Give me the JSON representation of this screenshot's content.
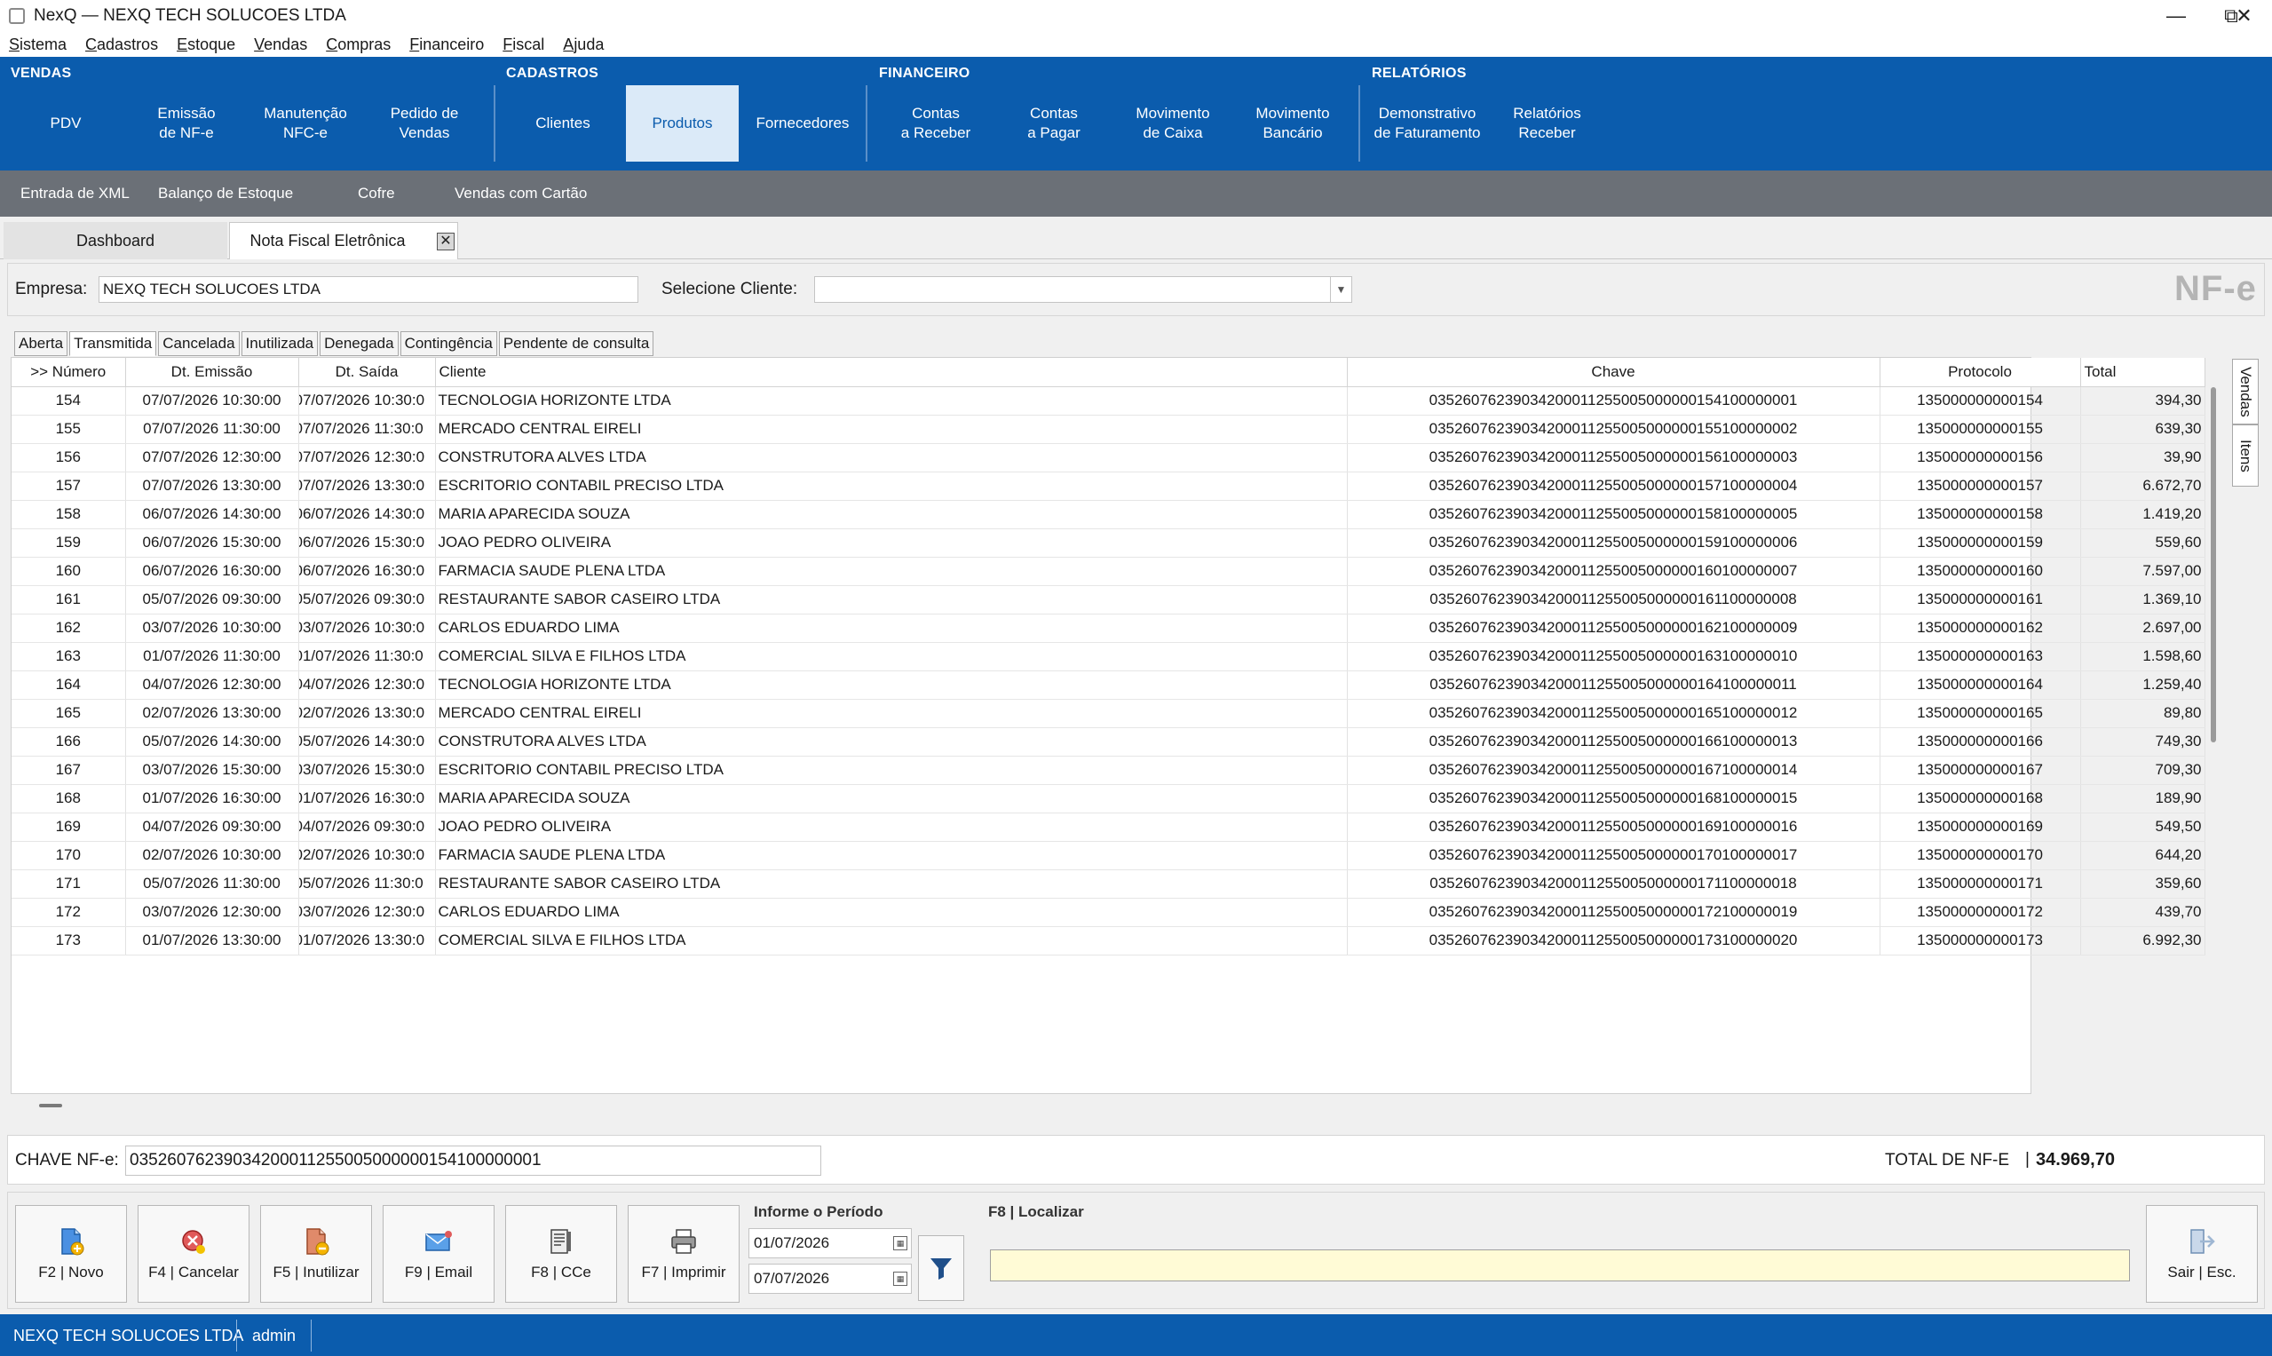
{
  "window": {
    "title": "NexQ — NEXQ TECH SOLUCOES LTDA"
  },
  "menu": [
    "Sistema",
    "Cadastros",
    "Estoque",
    "Vendas",
    "Compras",
    "Financeiro",
    "Fiscal",
    "Ajuda"
  ],
  "ribbon": {
    "groups": [
      "VENDAS",
      "CADASTROS",
      "FINANCEIRO",
      "RELATÓRIOS"
    ],
    "buttons": [
      "PDV",
      "Emissão\nde NF-e",
      "Manutenção\nNFC-e",
      "Pedido de\nVendas",
      "Clientes",
      "Produtos",
      "Fornecedores",
      "Contas\na Receber",
      "Contas\na Pagar",
      "Movimento\nde Caixa",
      "Movimento\nBancário",
      "Demonstrativo\nde Faturamento",
      "Relatórios\nReceber"
    ],
    "active": "Produtos"
  },
  "subbar": [
    "Entrada de XML",
    "Balanço de Estoque",
    "Cofre",
    "Vendas com Cartão"
  ],
  "doc_tabs": [
    "Dashboard",
    "Nota Fiscal Eletrônica"
  ],
  "filter": {
    "empresa_label": "Empresa:",
    "empresa_value": "NEXQ TECH SOLUCOES LTDA",
    "cliente_label": "Selecione Cliente:",
    "cliente_value": "",
    "logo": "NF-e"
  },
  "status_tabs": [
    "Aberta",
    "Transmitida",
    "Cancelada",
    "Inutilizada",
    "Denegada",
    "Contingência",
    "Pendente de consulta"
  ],
  "active_status_tab": "Transmitida",
  "grid": {
    "columns": [
      ">> Número",
      "Dt. Emissão",
      "Dt. Saída",
      "Cliente",
      "Chave",
      "Protocolo",
      "Total"
    ],
    "rows": [
      [
        "154",
        "07/07/2026 10:30:00",
        "07/07/2026 10:30:0",
        "TECNOLOGIA HORIZONTE LTDA",
        "03526076239034200011255005000000154100000001",
        "135000000000154",
        "394,30"
      ],
      [
        "155",
        "07/07/2026 11:30:00",
        "07/07/2026 11:30:0",
        "MERCADO CENTRAL EIRELI",
        "03526076239034200011255005000000155100000002",
        "135000000000155",
        "639,30"
      ],
      [
        "156",
        "07/07/2026 12:30:00",
        "07/07/2026 12:30:0",
        "CONSTRUTORA ALVES LTDA",
        "03526076239034200011255005000000156100000003",
        "135000000000156",
        "39,90"
      ],
      [
        "157",
        "07/07/2026 13:30:00",
        "07/07/2026 13:30:0",
        "ESCRITORIO CONTABIL PRECISO LTDA",
        "03526076239034200011255005000000157100000004",
        "135000000000157",
        "6.672,70"
      ],
      [
        "158",
        "06/07/2026 14:30:00",
        "06/07/2026 14:30:0",
        "MARIA APARECIDA SOUZA",
        "03526076239034200011255005000000158100000005",
        "135000000000158",
        "1.419,20"
      ],
      [
        "159",
        "06/07/2026 15:30:00",
        "06/07/2026 15:30:0",
        "JOAO PEDRO OLIVEIRA",
        "03526076239034200011255005000000159100000006",
        "135000000000159",
        "559,60"
      ],
      [
        "160",
        "06/07/2026 16:30:00",
        "06/07/2026 16:30:0",
        "FARMACIA SAUDE PLENA LTDA",
        "03526076239034200011255005000000160100000007",
        "135000000000160",
        "7.597,00"
      ],
      [
        "161",
        "05/07/2026 09:30:00",
        "05/07/2026 09:30:0",
        "RESTAURANTE SABOR CASEIRO LTDA",
        "03526076239034200011255005000000161100000008",
        "135000000000161",
        "1.369,10"
      ],
      [
        "162",
        "03/07/2026 10:30:00",
        "03/07/2026 10:30:0",
        "CARLOS EDUARDO LIMA",
        "03526076239034200011255005000000162100000009",
        "135000000000162",
        "2.697,00"
      ],
      [
        "163",
        "01/07/2026 11:30:00",
        "01/07/2026 11:30:0",
        "COMERCIAL SILVA E FILHOS LTDA",
        "03526076239034200011255005000000163100000010",
        "135000000000163",
        "1.598,60"
      ],
      [
        "164",
        "04/07/2026 12:30:00",
        "04/07/2026 12:30:0",
        "TECNOLOGIA HORIZONTE LTDA",
        "03526076239034200011255005000000164100000011",
        "135000000000164",
        "1.259,40"
      ],
      [
        "165",
        "02/07/2026 13:30:00",
        "02/07/2026 13:30:0",
        "MERCADO CENTRAL EIRELI",
        "03526076239034200011255005000000165100000012",
        "135000000000165",
        "89,80"
      ],
      [
        "166",
        "05/07/2026 14:30:00",
        "05/07/2026 14:30:0",
        "CONSTRUTORA ALVES LTDA",
        "03526076239034200011255005000000166100000013",
        "135000000000166",
        "749,30"
      ],
      [
        "167",
        "03/07/2026 15:30:00",
        "03/07/2026 15:30:0",
        "ESCRITORIO CONTABIL PRECISO LTDA",
        "03526076239034200011255005000000167100000014",
        "135000000000167",
        "709,30"
      ],
      [
        "168",
        "01/07/2026 16:30:00",
        "01/07/2026 16:30:0",
        "MARIA APARECIDA SOUZA",
        "03526076239034200011255005000000168100000015",
        "135000000000168",
        "189,90"
      ],
      [
        "169",
        "04/07/2026 09:30:00",
        "04/07/2026 09:30:0",
        "JOAO PEDRO OLIVEIRA",
        "03526076239034200011255005000000169100000016",
        "135000000000169",
        "549,50"
      ],
      [
        "170",
        "02/07/2026 10:30:00",
        "02/07/2026 10:30:0",
        "FARMACIA SAUDE PLENA LTDA",
        "03526076239034200011255005000000170100000017",
        "135000000000170",
        "644,20"
      ],
      [
        "171",
        "05/07/2026 11:30:00",
        "05/07/2026 11:30:0",
        "RESTAURANTE SABOR CASEIRO LTDA",
        "03526076239034200011255005000000171100000018",
        "135000000000171",
        "359,60"
      ],
      [
        "172",
        "03/07/2026 12:30:00",
        "03/07/2026 12:30:0",
        "CARLOS EDUARDO LIMA",
        "03526076239034200011255005000000172100000019",
        "135000000000172",
        "439,70"
      ],
      [
        "173",
        "01/07/2026 13:30:00",
        "01/07/2026 13:30:0",
        "COMERCIAL SILVA E FILHOS LTDA",
        "03526076239034200011255005000000173100000020",
        "135000000000173",
        "6.992,30"
      ]
    ]
  },
  "side_tabs": [
    "Vendas",
    "Itens"
  ],
  "chave": {
    "label": "CHAVE NF-e:",
    "value": "03526076239034200011255005000000154100000001",
    "total_label": "TOTAL DE NF-E",
    "total_sep": "|",
    "total_value": "34.969,70"
  },
  "actions": {
    "novo": "F2 | Novo",
    "cancelar": "F4 | Cancelar",
    "inutilizar": "F5 | Inutilizar",
    "email": "F9 | Email",
    "cce": "F8 | CCe",
    "imprimir": "F7 | Imprimir",
    "sair": "Sair | Esc."
  },
  "period": {
    "label": "Informe o Período",
    "from": "01/07/2026",
    "to": "07/07/2026"
  },
  "localizar": {
    "label": "F8 | Localizar",
    "value": ""
  },
  "statusbar": {
    "company": "NEXQ TECH SOLUCOES LTDA",
    "user": "admin"
  },
  "colors": {
    "brand": "#0b5cad",
    "subbar": "#6b7077",
    "active_button": "#dbeaf8",
    "search_bg": "#fffbd6"
  }
}
